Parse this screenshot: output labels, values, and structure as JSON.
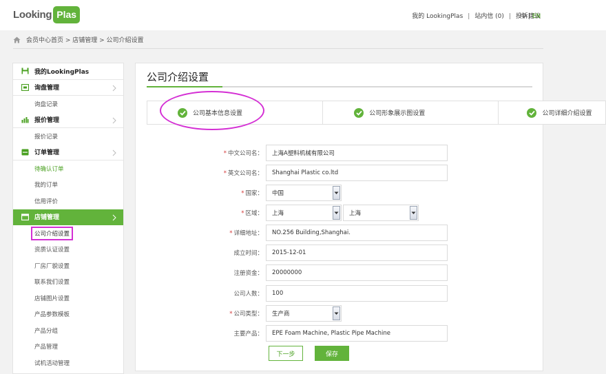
{
  "header": {
    "logo_part1": "Looking",
    "logo_part2": "Plas",
    "link_my": "我的 LookingPlas",
    "link_messages": "站内信 (0)",
    "link_feedback": "投诉建议",
    "lang_zh": "中",
    "lang_sep": " | ",
    "lang_en": "EN"
  },
  "breadcrumb": {
    "text": "会员中心首页 > 店铺管理 > 公司介绍设置"
  },
  "sidebar": {
    "title": "我的LookingPlas",
    "sections": [
      {
        "label": "询盘管理",
        "items": [
          "询盘记录"
        ]
      },
      {
        "label": "报价管理",
        "items": [
          "报价记录"
        ]
      },
      {
        "label": "订单管理",
        "items": [
          "待确认订单",
          "我的订单",
          "信用评价"
        ]
      },
      {
        "label": "店铺管理",
        "items": [
          "公司介绍设置",
          "资质认证设置",
          "厂房厂貌设置",
          "联系我们设置",
          "店铺图片设置",
          "产品参数模板",
          "产品分组",
          "产品管理",
          "试机活动管理"
        ]
      }
    ],
    "active_section": "店铺管理",
    "active_item": "公司介绍设置",
    "accent_color": "#62b33b"
  },
  "main": {
    "title": "公司介绍设置",
    "steps": [
      "公司基本信息设置",
      "公司形象展示图设置",
      "公司详细介绍设置"
    ],
    "form": {
      "cn_name_label": "中文公司名：",
      "cn_name_value": "上海A塑料机械有限公司",
      "en_name_label": "英文公司名：",
      "en_name_value": "Shanghai Plastic co.ltd",
      "country_label": "国家：",
      "country_value": "中国",
      "region_label": "区域：",
      "region_province": "上海",
      "region_city": "上海",
      "address_label": "详细地址：",
      "address_value": "NO.256 Building,Shanghai.",
      "founded_label": "成立时间：",
      "founded_value": "2015-12-01",
      "capital_label": "注册资金：",
      "capital_value": "20000000",
      "staff_label": "公司人数：",
      "staff_value": "100",
      "type_label": "公司类型：",
      "type_value": "生产商",
      "products_label": "主要产品：",
      "products_value": "EPE Foam Machine, Plastic Pipe Machine"
    },
    "btn_next": "下一步",
    "btn_save": "保存"
  }
}
